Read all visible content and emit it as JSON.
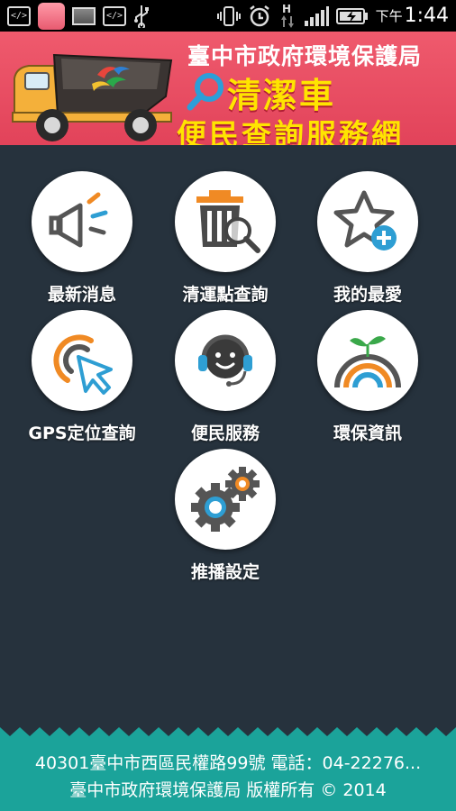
{
  "status_bar": {
    "ampm": "下午",
    "time": "1:44",
    "network": "H"
  },
  "banner": {
    "line1": "臺中市政府環境保護局",
    "line2": "清潔車",
    "line3": "便民查詢服務網"
  },
  "menu": {
    "news": "最新消息",
    "cleanup_points": "清運點查詢",
    "favorites": "我的最愛",
    "gps": "GPS定位查詢",
    "service": "便民服務",
    "env_info": "環保資訊",
    "push_settings": "推播設定"
  },
  "footer": {
    "address": "40301臺中市西區民權路99號 電話：04-22276...",
    "copyright": "臺中市政府環境保護局 版權所有 © 2014"
  },
  "colors": {
    "banner": "#e2435a",
    "banner_text_yellow": "#ffe400",
    "background": "#26323d",
    "footer": "#1ba39a",
    "accent_orange": "#f08a24",
    "accent_blue": "#2e9ed3"
  }
}
